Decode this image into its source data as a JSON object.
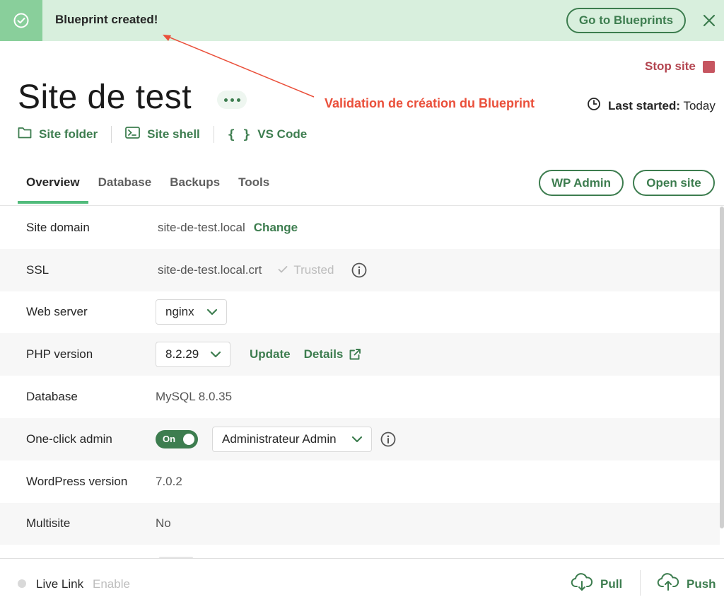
{
  "banner": {
    "message": "Blueprint created!",
    "action_label": "Go to Blueprints",
    "icons": {
      "status": "check-circle-icon",
      "close": "close-icon"
    }
  },
  "header": {
    "stop_site_label": "Stop site",
    "site_title": "Site de test",
    "last_started_label": "Last started:",
    "last_started_value": "Today",
    "quick_links": [
      {
        "label": "Site folder",
        "icon": "folder-icon"
      },
      {
        "label": "Site shell",
        "icon": "terminal-icon"
      },
      {
        "label": "VS Code",
        "icon": "code-braces-icon"
      }
    ]
  },
  "annotation": {
    "text": "Validation de création du Blueprint",
    "color": "#ea4f3a"
  },
  "tabs": [
    {
      "label": "Overview",
      "active": true
    },
    {
      "label": "Database",
      "active": false
    },
    {
      "label": "Backups",
      "active": false
    },
    {
      "label": "Tools",
      "active": false
    }
  ],
  "actions": {
    "wp_admin": "WP Admin",
    "open_site": "Open site"
  },
  "overview": {
    "site_domain": {
      "label": "Site domain",
      "value": "site-de-test.local",
      "action": "Change"
    },
    "ssl": {
      "label": "SSL",
      "value": "site-de-test.local.crt",
      "status": "Trusted"
    },
    "web_server": {
      "label": "Web server",
      "value": "nginx"
    },
    "php_version": {
      "label": "PHP version",
      "value": "8.2.29",
      "update": "Update",
      "details": "Details"
    },
    "database": {
      "label": "Database",
      "value": "MySQL 8.0.35"
    },
    "one_click_admin": {
      "label": "One-click admin",
      "toggle": "On",
      "user": "Administrateur Admin"
    },
    "wordpress_version": {
      "label": "WordPress version",
      "value": "7.0.2"
    },
    "multisite": {
      "label": "Multisite",
      "value": "No"
    }
  },
  "footer": {
    "live_link_label": "Live Link",
    "live_link_action": "Enable",
    "pull_label": "Pull",
    "push_label": "Push"
  },
  "colors": {
    "accent": "#3d7d4f",
    "tab_indicator": "#51bb7b",
    "banner_bg": "#d8efdd",
    "stop": "#b3444f"
  }
}
